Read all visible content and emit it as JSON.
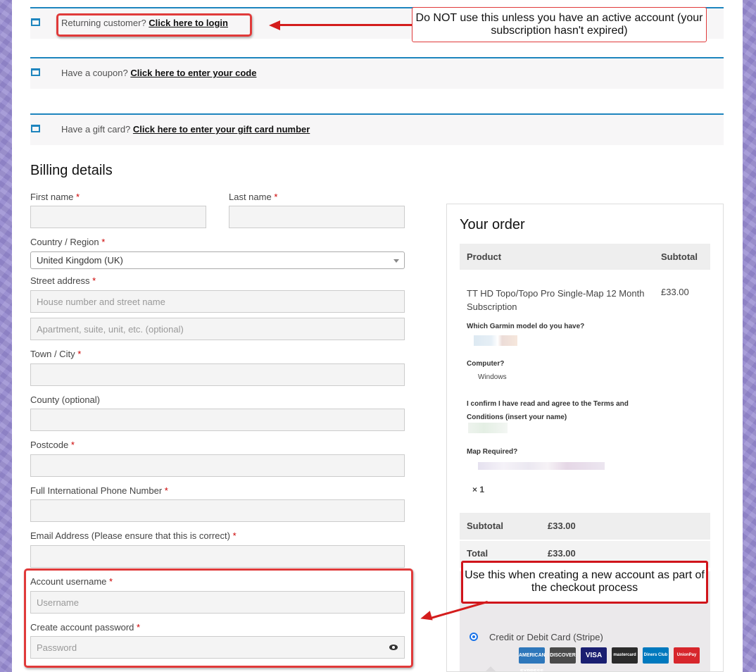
{
  "notices": {
    "login": {
      "text": "Returning customer?",
      "link": "Click here to login"
    },
    "coupon": {
      "text": "Have a coupon?",
      "link": "Click here to enter your code"
    },
    "gift": {
      "text": "Have a gift card?",
      "link": "Click here to enter your gift card number"
    }
  },
  "billing": {
    "title": "Billing details",
    "required_mark": "*",
    "first_name": "First name",
    "last_name": "Last name",
    "country_label": "Country / Region",
    "country_value": "United Kingdom (UK)",
    "street_label": "Street address",
    "street_placeholder": "House number and street name",
    "street2_placeholder": "Apartment, suite, unit, etc. (optional)",
    "town_label": "Town / City",
    "county_label": "County (optional)",
    "postcode_label": "Postcode",
    "phone_label": "Full International Phone Number",
    "email_label": "Email Address (Please ensure that this is correct)",
    "username_label": "Account username",
    "username_placeholder": "Username",
    "password_label": "Create account password",
    "password_placeholder": "Password"
  },
  "order": {
    "title": "Your order",
    "col_product": "Product",
    "col_subtotal": "Subtotal",
    "item_name": "TT HD Topo/Topo Pro Single-Map 12 Month Subscription",
    "item_price": "£33.00",
    "meta": [
      {
        "key": "Which Garmin model do you have?",
        "value": ""
      },
      {
        "key": "Computer?",
        "value": "Windows"
      },
      {
        "key": "I confirm I have read and agree to the Terms and Conditions (insert your name)",
        "value": ""
      },
      {
        "key": "Map Required?",
        "value": ""
      }
    ],
    "quantity": "× 1",
    "subtotal_label": "Subtotal",
    "subtotal_value": "£33.00",
    "total_label": "Total",
    "total_value": "£33.00",
    "payment_label": "Credit or Debit Card (Stripe)",
    "cards": [
      {
        "name": "AMERICAN EXPRESS",
        "color": "#2e77bb"
      },
      {
        "name": "DISCOVER",
        "color": "#4a4a4a"
      },
      {
        "name": "VISA",
        "color": "#1a1f71"
      },
      {
        "name": "mastercard",
        "color": "#2b2b2b"
      },
      {
        "name": "Diners Club",
        "color": "#0079be"
      },
      {
        "name": "UnionPay",
        "color": "#d7262c"
      }
    ]
  },
  "annotations": {
    "callout_login": "Do NOT use this unless you have an active account (your subscription hasn't expired)",
    "callout_account": "Use this when creating a new account as part of the checkout process"
  },
  "colors": {
    "accent": "#1e85be",
    "annotation_red": "#e03a3a",
    "required": "#cc0000"
  }
}
